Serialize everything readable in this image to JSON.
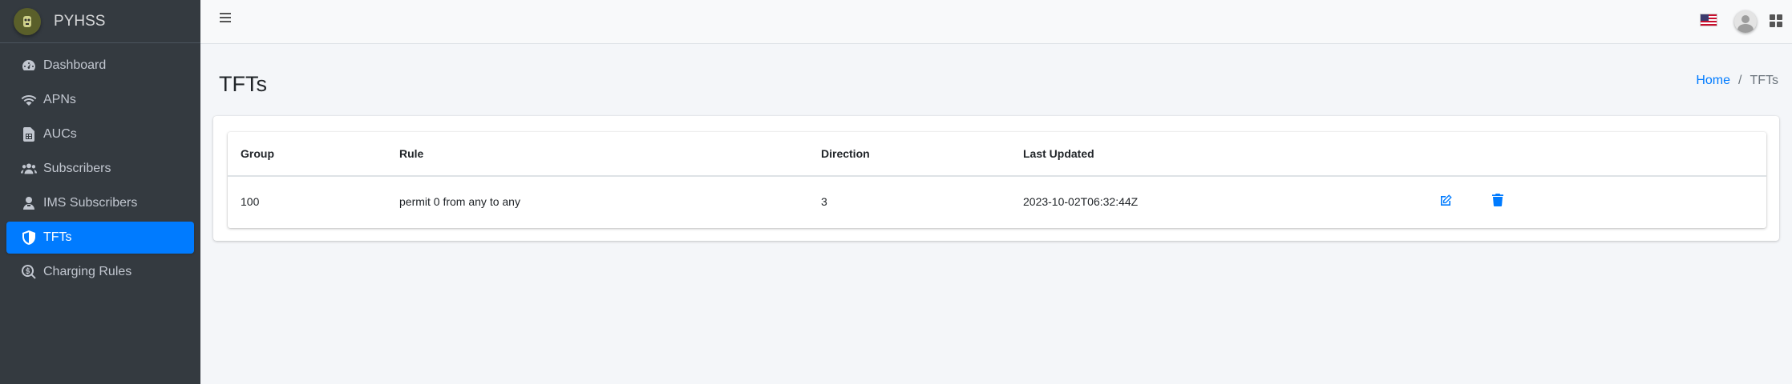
{
  "brand": {
    "name": "PYHSS"
  },
  "sidebar": {
    "items": [
      {
        "label": "Dashboard",
        "icon": "dashboard-icon"
      },
      {
        "label": "APNs",
        "icon": "wifi-icon"
      },
      {
        "label": "AUCs",
        "icon": "sim-card-icon"
      },
      {
        "label": "Subscribers",
        "icon": "users-icon"
      },
      {
        "label": "IMS Subscribers",
        "icon": "user-icon"
      },
      {
        "label": "TFTs",
        "icon": "shield-icon",
        "active": true
      },
      {
        "label": "Charging Rules",
        "icon": "search-dollar-icon"
      }
    ]
  },
  "page": {
    "title": "TFTs"
  },
  "breadcrumb": {
    "home": "Home",
    "separator": "/",
    "current": "TFTs"
  },
  "table": {
    "headers": [
      "Group",
      "Rule",
      "Direction",
      "Last Updated"
    ],
    "rows": [
      {
        "group": "100",
        "rule": "permit 0 from any to any",
        "direction": "3",
        "last_updated": "2023-10-02T06:32:44Z"
      }
    ]
  },
  "colors": {
    "accent": "#007bff",
    "sidebar_bg": "#343a40"
  }
}
